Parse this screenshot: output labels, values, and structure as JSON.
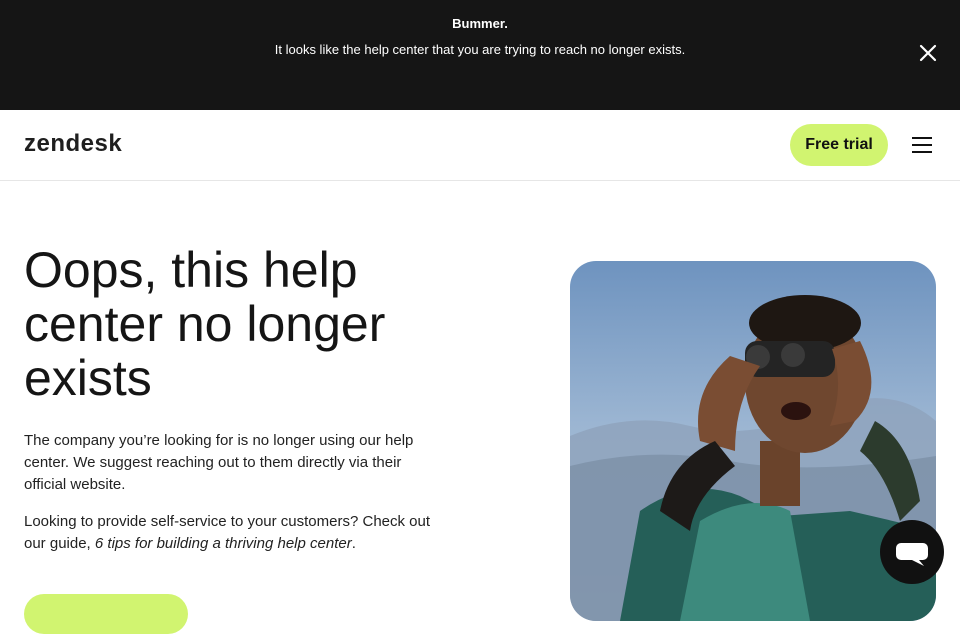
{
  "banner": {
    "title": "Bummer.",
    "message": "It looks like the help center that you are trying to reach no longer exists."
  },
  "header": {
    "logo": "zendesk",
    "trial_label": "Free trial"
  },
  "hero": {
    "title": "Oops, this help center no longer exists",
    "paragraph1": "The company you’re looking for is no longer using our help center. We suggest reaching out to them directly via their official website.",
    "paragraph2_prefix": "Looking to provide self-service to your customers? Check out our guide, ",
    "guide_link": "6 tips for building a thriving help center",
    "paragraph2_suffix": "."
  },
  "icons": {
    "close": "close-icon",
    "menu": "hamburger-menu-icon",
    "chat": "chat-bubble-icon"
  },
  "colors": {
    "banner_bg": "#151515",
    "accent": "#d1f470",
    "text": "#111111"
  }
}
